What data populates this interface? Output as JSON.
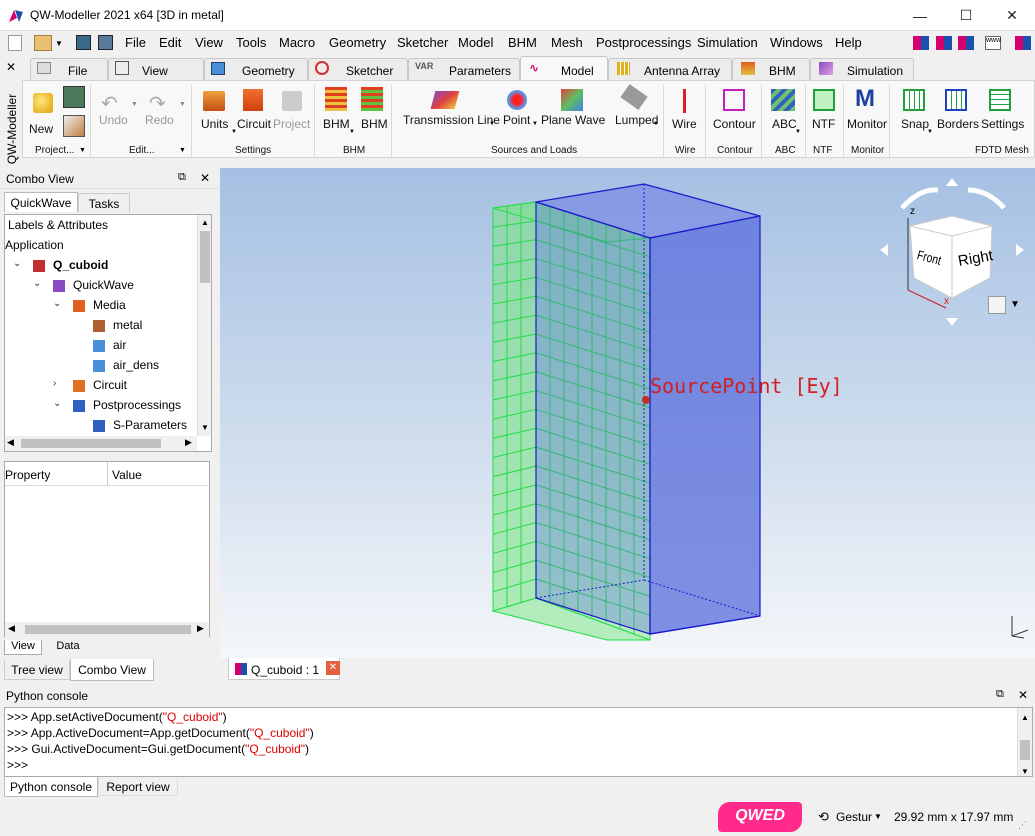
{
  "window": {
    "title": "QW-Modeller 2021 x64 [3D in metal]",
    "controls": {
      "minimize": "—",
      "maximize": "☐",
      "close": "✕"
    }
  },
  "menubar": {
    "items": [
      "File",
      "Edit",
      "View",
      "Tools",
      "Macro",
      "Geometry",
      "Sketcher",
      "Model",
      "BHM",
      "Mesh",
      "Postprocessings",
      "Simulation",
      "Windows",
      "Help"
    ]
  },
  "side_label": "QW-Modeller",
  "ribbon_tabs": [
    "File",
    "View",
    "Geometry",
    "Sketcher",
    "Parameters",
    "Model",
    "Antenna Array",
    "BHM",
    "Simulation"
  ],
  "ribbon_tabs_active": "Model",
  "ribbon": {
    "buttons": {
      "new": "New",
      "undo": "Undo",
      "redo": "Redo",
      "units": "Units",
      "circuit": "Circuit",
      "project": "Project",
      "bhm1": "BHM",
      "bhm2": "BHM",
      "transmission_line": "Transmission Line",
      "point": "Point",
      "plane_wave": "Plane Wave",
      "lumped": "Lumped",
      "wire": "Wire",
      "contour": "Contour",
      "abc": "ABC",
      "ntf": "NTF",
      "monitor": "Monitor",
      "snap": "Snap",
      "borders": "Borders",
      "settings": "Settings"
    },
    "groups": {
      "project": "Project...",
      "edit": "Edit...",
      "settings": "Settings",
      "bhm": "BHM",
      "sources": "Sources and Loads",
      "wire": "Wire",
      "contour": "Contour",
      "abc": "ABC",
      "ntf": "NTF",
      "monitor": "Monitor",
      "fdtd": "FDTD Mesh"
    }
  },
  "combo_view": {
    "title": "Combo View",
    "tabs": [
      "QuickWave",
      "Tasks"
    ],
    "tree_header": "Labels & Attributes",
    "tree": [
      {
        "label": "Application",
        "level": 0,
        "expander": ""
      },
      {
        "label": "Q_cuboid",
        "level": 1,
        "expander": "v",
        "bold": true
      },
      {
        "label": "QuickWave",
        "level": 2,
        "expander": "v"
      },
      {
        "label": "Media",
        "level": 3,
        "expander": "v"
      },
      {
        "label": "metal",
        "level": 4,
        "expander": ""
      },
      {
        "label": "air",
        "level": 4,
        "expander": ""
      },
      {
        "label": "air_dens",
        "level": 4,
        "expander": ""
      },
      {
        "label": "Circuit",
        "level": 3,
        "expander": ">"
      },
      {
        "label": "Postprocessings",
        "level": 3,
        "expander": "v"
      },
      {
        "label": "S-Parameters",
        "level": 4,
        "expander": ""
      }
    ],
    "property_header": {
      "property": "Property",
      "value": "Value"
    },
    "bottom_tabs": [
      "View",
      "Data"
    ],
    "panel_tabs": [
      "Tree view",
      "Combo View"
    ]
  },
  "viewport": {
    "annotation": "SourcePoint [Ey]",
    "navcube_faces": {
      "front": "Front",
      "right": "Right"
    },
    "axis_labels": {
      "z": "z",
      "x": "x"
    }
  },
  "document_tab": "Q_cuboid : 1",
  "python_console": {
    "title": "Python console",
    "lines": [
      {
        "prompt": ">>> ",
        "pre": "App.setActiveDocument(",
        "str": "\"Q_cuboid\"",
        "post": ")"
      },
      {
        "prompt": ">>> ",
        "pre": "App.ActiveDocument=App.getDocument(",
        "str": "\"Q_cuboid\"",
        "post": ")"
      },
      {
        "prompt": ">>> ",
        "pre": "Gui.ActiveDocument=Gui.getDocument(",
        "str": "\"Q_cuboid\"",
        "post": ")"
      },
      {
        "prompt": ">>> ",
        "pre": "",
        "str": "",
        "post": ""
      }
    ],
    "tabs": [
      "Python console",
      "Report view"
    ]
  },
  "statusbar": {
    "navigation": "Gestur",
    "dimensions": "29.92 mm x 17.97 mm"
  },
  "colors": {
    "accent": "#d4006e",
    "mesh_green": "#22dd44",
    "cuboid_blue": "#1a1acc",
    "source_red": "#c03020"
  }
}
